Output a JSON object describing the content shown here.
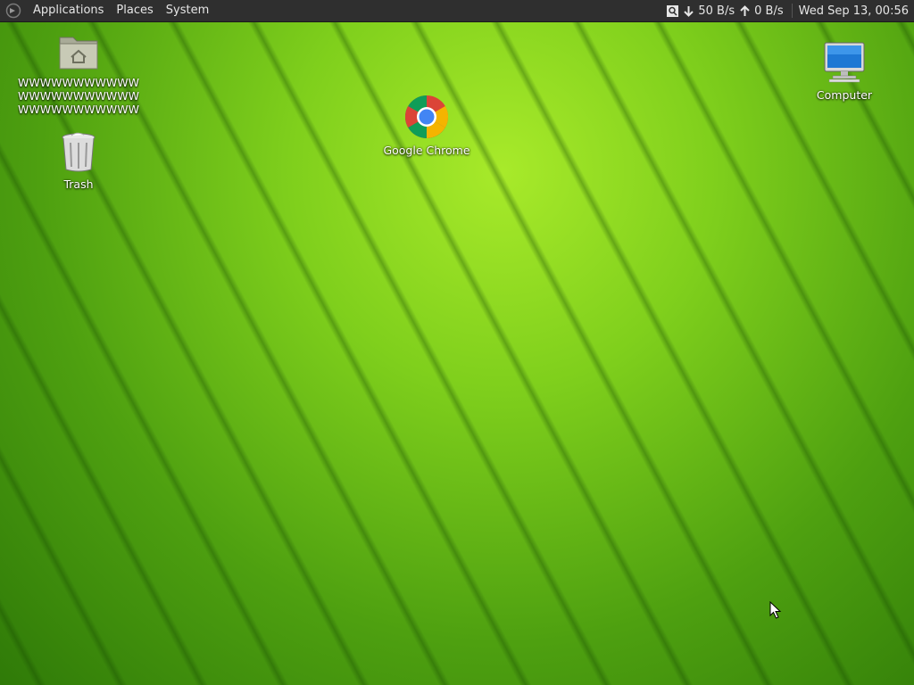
{
  "panel": {
    "menus": [
      "Applications",
      "Places",
      "System"
    ],
    "network": {
      "download": "50 B/s",
      "upload": "0 B/s"
    },
    "clock": "Wed Sep 13, 00:56"
  },
  "desktop": {
    "icons": {
      "home": {
        "label": "WWWWWWWWWWWWWWWWWWWWWWWWWWWWWWWWWWWW...",
        "icon": "home-folder-icon"
      },
      "trash": {
        "label": "Trash",
        "icon": "trash-icon"
      },
      "chrome": {
        "label": "Google Chrome",
        "icon": "chrome-icon"
      },
      "computer": {
        "label": "Computer",
        "icon": "computer-icon"
      }
    }
  },
  "colors": {
    "panel_bg": "#2f2f2f",
    "wallpaper_green": "#7fcf1c"
  }
}
